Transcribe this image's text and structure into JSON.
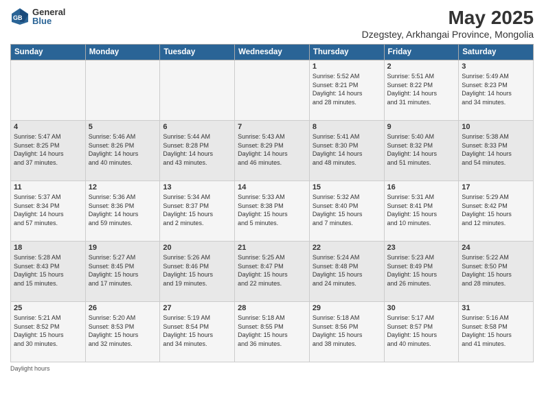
{
  "header": {
    "logo_general": "General",
    "logo_blue": "Blue",
    "month_title": "May 2025",
    "subtitle": "Dzegstey, Arkhangai Province, Mongolia"
  },
  "days_of_week": [
    "Sunday",
    "Monday",
    "Tuesday",
    "Wednesday",
    "Thursday",
    "Friday",
    "Saturday"
  ],
  "weeks": [
    [
      {
        "day": "",
        "info": ""
      },
      {
        "day": "",
        "info": ""
      },
      {
        "day": "",
        "info": ""
      },
      {
        "day": "",
        "info": ""
      },
      {
        "day": "1",
        "info": "Sunrise: 5:52 AM\nSunset: 8:21 PM\nDaylight: 14 hours\nand 28 minutes."
      },
      {
        "day": "2",
        "info": "Sunrise: 5:51 AM\nSunset: 8:22 PM\nDaylight: 14 hours\nand 31 minutes."
      },
      {
        "day": "3",
        "info": "Sunrise: 5:49 AM\nSunset: 8:23 PM\nDaylight: 14 hours\nand 34 minutes."
      }
    ],
    [
      {
        "day": "4",
        "info": "Sunrise: 5:47 AM\nSunset: 8:25 PM\nDaylight: 14 hours\nand 37 minutes."
      },
      {
        "day": "5",
        "info": "Sunrise: 5:46 AM\nSunset: 8:26 PM\nDaylight: 14 hours\nand 40 minutes."
      },
      {
        "day": "6",
        "info": "Sunrise: 5:44 AM\nSunset: 8:28 PM\nDaylight: 14 hours\nand 43 minutes."
      },
      {
        "day": "7",
        "info": "Sunrise: 5:43 AM\nSunset: 8:29 PM\nDaylight: 14 hours\nand 46 minutes."
      },
      {
        "day": "8",
        "info": "Sunrise: 5:41 AM\nSunset: 8:30 PM\nDaylight: 14 hours\nand 48 minutes."
      },
      {
        "day": "9",
        "info": "Sunrise: 5:40 AM\nSunset: 8:32 PM\nDaylight: 14 hours\nand 51 minutes."
      },
      {
        "day": "10",
        "info": "Sunrise: 5:38 AM\nSunset: 8:33 PM\nDaylight: 14 hours\nand 54 minutes."
      }
    ],
    [
      {
        "day": "11",
        "info": "Sunrise: 5:37 AM\nSunset: 8:34 PM\nDaylight: 14 hours\nand 57 minutes."
      },
      {
        "day": "12",
        "info": "Sunrise: 5:36 AM\nSunset: 8:36 PM\nDaylight: 14 hours\nand 59 minutes."
      },
      {
        "day": "13",
        "info": "Sunrise: 5:34 AM\nSunset: 8:37 PM\nDaylight: 15 hours\nand 2 minutes."
      },
      {
        "day": "14",
        "info": "Sunrise: 5:33 AM\nSunset: 8:38 PM\nDaylight: 15 hours\nand 5 minutes."
      },
      {
        "day": "15",
        "info": "Sunrise: 5:32 AM\nSunset: 8:40 PM\nDaylight: 15 hours\nand 7 minutes."
      },
      {
        "day": "16",
        "info": "Sunrise: 5:31 AM\nSunset: 8:41 PM\nDaylight: 15 hours\nand 10 minutes."
      },
      {
        "day": "17",
        "info": "Sunrise: 5:29 AM\nSunset: 8:42 PM\nDaylight: 15 hours\nand 12 minutes."
      }
    ],
    [
      {
        "day": "18",
        "info": "Sunrise: 5:28 AM\nSunset: 8:43 PM\nDaylight: 15 hours\nand 15 minutes."
      },
      {
        "day": "19",
        "info": "Sunrise: 5:27 AM\nSunset: 8:45 PM\nDaylight: 15 hours\nand 17 minutes."
      },
      {
        "day": "20",
        "info": "Sunrise: 5:26 AM\nSunset: 8:46 PM\nDaylight: 15 hours\nand 19 minutes."
      },
      {
        "day": "21",
        "info": "Sunrise: 5:25 AM\nSunset: 8:47 PM\nDaylight: 15 hours\nand 22 minutes."
      },
      {
        "day": "22",
        "info": "Sunrise: 5:24 AM\nSunset: 8:48 PM\nDaylight: 15 hours\nand 24 minutes."
      },
      {
        "day": "23",
        "info": "Sunrise: 5:23 AM\nSunset: 8:49 PM\nDaylight: 15 hours\nand 26 minutes."
      },
      {
        "day": "24",
        "info": "Sunrise: 5:22 AM\nSunset: 8:50 PM\nDaylight: 15 hours\nand 28 minutes."
      }
    ],
    [
      {
        "day": "25",
        "info": "Sunrise: 5:21 AM\nSunset: 8:52 PM\nDaylight: 15 hours\nand 30 minutes."
      },
      {
        "day": "26",
        "info": "Sunrise: 5:20 AM\nSunset: 8:53 PM\nDaylight: 15 hours\nand 32 minutes."
      },
      {
        "day": "27",
        "info": "Sunrise: 5:19 AM\nSunset: 8:54 PM\nDaylight: 15 hours\nand 34 minutes."
      },
      {
        "day": "28",
        "info": "Sunrise: 5:18 AM\nSunset: 8:55 PM\nDaylight: 15 hours\nand 36 minutes."
      },
      {
        "day": "29",
        "info": "Sunrise: 5:18 AM\nSunset: 8:56 PM\nDaylight: 15 hours\nand 38 minutes."
      },
      {
        "day": "30",
        "info": "Sunrise: 5:17 AM\nSunset: 8:57 PM\nDaylight: 15 hours\nand 40 minutes."
      },
      {
        "day": "31",
        "info": "Sunrise: 5:16 AM\nSunset: 8:58 PM\nDaylight: 15 hours\nand 41 minutes."
      }
    ]
  ],
  "footer": {
    "text": "Daylight hours"
  }
}
